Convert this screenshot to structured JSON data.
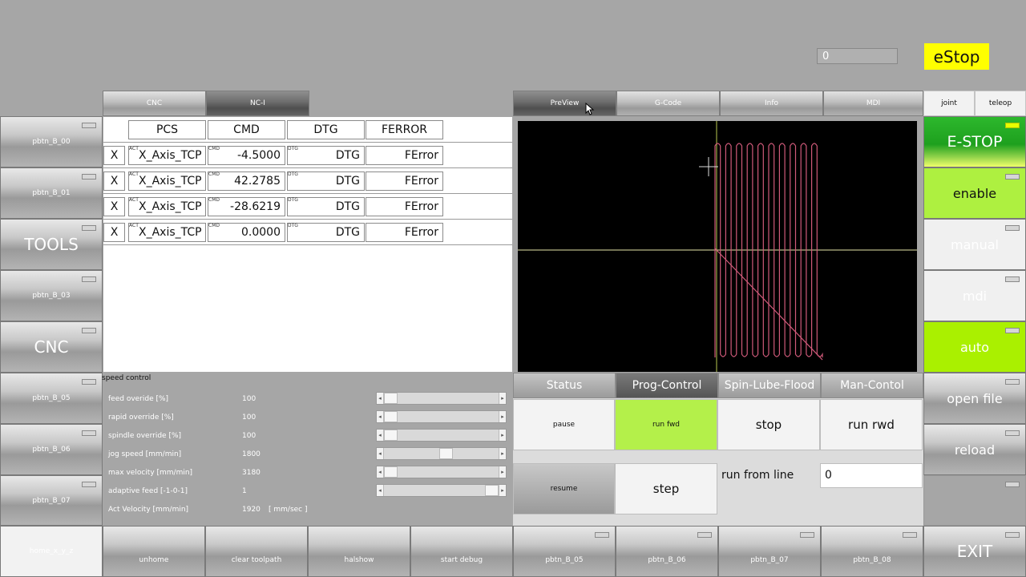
{
  "top": {
    "counter_value": "0",
    "estop_label": "eStop"
  },
  "left_tabs": [
    {
      "label": "CNC",
      "active": false
    },
    {
      "label": "NC-I",
      "active": true
    }
  ],
  "right_tabs": [
    {
      "label": "PreView",
      "active": true
    },
    {
      "label": "G-Code",
      "active": false
    },
    {
      "label": "Info",
      "active": false
    },
    {
      "label": "MDI",
      "active": false
    }
  ],
  "mode_tabs": [
    {
      "label": "joint"
    },
    {
      "label": "teleop"
    }
  ],
  "left_buttons": [
    {
      "label": "pbtn_B_00"
    },
    {
      "label": "pbtn_B_01"
    },
    {
      "label": "TOOLS"
    },
    {
      "label": "pbtn_B_03"
    },
    {
      "label": "CNC"
    },
    {
      "label": "pbtn_B_05"
    },
    {
      "label": "pbtn_B_06"
    },
    {
      "label": "pbtn_B_07"
    }
  ],
  "right_buttons": [
    {
      "label": "E-STOP"
    },
    {
      "label": "enable"
    },
    {
      "label": "manual"
    },
    {
      "label": "mdi"
    },
    {
      "label": "auto"
    },
    {
      "label": "open file"
    },
    {
      "label": "reload"
    },
    {
      "label": ""
    }
  ],
  "bottom_buttons": [
    {
      "label": "home_x_y_z"
    },
    {
      "label": "unhome"
    },
    {
      "label": "clear toolpath"
    },
    {
      "label": "halshow"
    },
    {
      "label": "start debug"
    },
    {
      "label": "pbtn_B_05"
    },
    {
      "label": "pbtn_B_06"
    },
    {
      "label": "pbtn_B_07"
    },
    {
      "label": "pbtn_B_08"
    },
    {
      "label": "EXIT"
    }
  ],
  "dro": {
    "headers": [
      "PCS",
      "CMD",
      "DTG",
      "FERROR"
    ],
    "tag_act": "ACT",
    "tag_cmd": "CMD",
    "tag_dtg": "DTG",
    "rows": [
      {
        "axis": "X",
        "name": "X_Axis_TCP",
        "cmd": "-4.5000",
        "dtg": "DTG",
        "ferror": "FError"
      },
      {
        "axis": "X",
        "name": "X_Axis_TCP",
        "cmd": "42.2785",
        "dtg": "DTG",
        "ferror": "FError"
      },
      {
        "axis": "X",
        "name": "X_Axis_TCP",
        "cmd": "-28.6219",
        "dtg": "DTG",
        "ferror": "FError"
      },
      {
        "axis": "X",
        "name": "X_Axis_TCP",
        "cmd": "0.0000",
        "dtg": "DTG",
        "ferror": "FError"
      }
    ]
  },
  "speed_control": {
    "title": "speed control",
    "items": [
      {
        "label": "feed overide [%]",
        "value": "100",
        "fraction": 0.0
      },
      {
        "label": "rapid override [%]",
        "value": "100",
        "fraction": 0.0
      },
      {
        "label": "spindle override [%]",
        "value": "100",
        "fraction": 0.0
      },
      {
        "label": "jog speed [mm/min]",
        "value": "1800",
        "fraction": 0.55
      },
      {
        "label": "max velocity [mm/min]",
        "value": "3180",
        "fraction": 0.0
      },
      {
        "label": "adaptive feed [-1-0-1]",
        "value": "1",
        "fraction": 1.0
      }
    ],
    "act_velocity_label": "Act Velocity [mm/min]",
    "act_velocity_value": "1920",
    "act_velocity_unit": "[ mm/sec ]"
  },
  "sub_tabs": [
    {
      "label": "Status",
      "active": false
    },
    {
      "label": "Prog-Control",
      "active": true
    },
    {
      "label": "Spin-Lube-Flood",
      "active": false
    },
    {
      "label": "Man-Contol",
      "active": false
    }
  ],
  "prog_control": {
    "pause": "pause",
    "run_fwd": "run fwd",
    "stop": "stop",
    "run_rwd": "run rwd",
    "resume": "resume",
    "step": "step",
    "run_from_line_label": "run from line",
    "run_from_line_value": "0"
  },
  "colors": {
    "estop_yellow": "#ffff00",
    "green_active": "#b4f04a",
    "green_enable": "#aef040",
    "toolpath": "#d05a7a",
    "axis": "#e6e6a8"
  }
}
